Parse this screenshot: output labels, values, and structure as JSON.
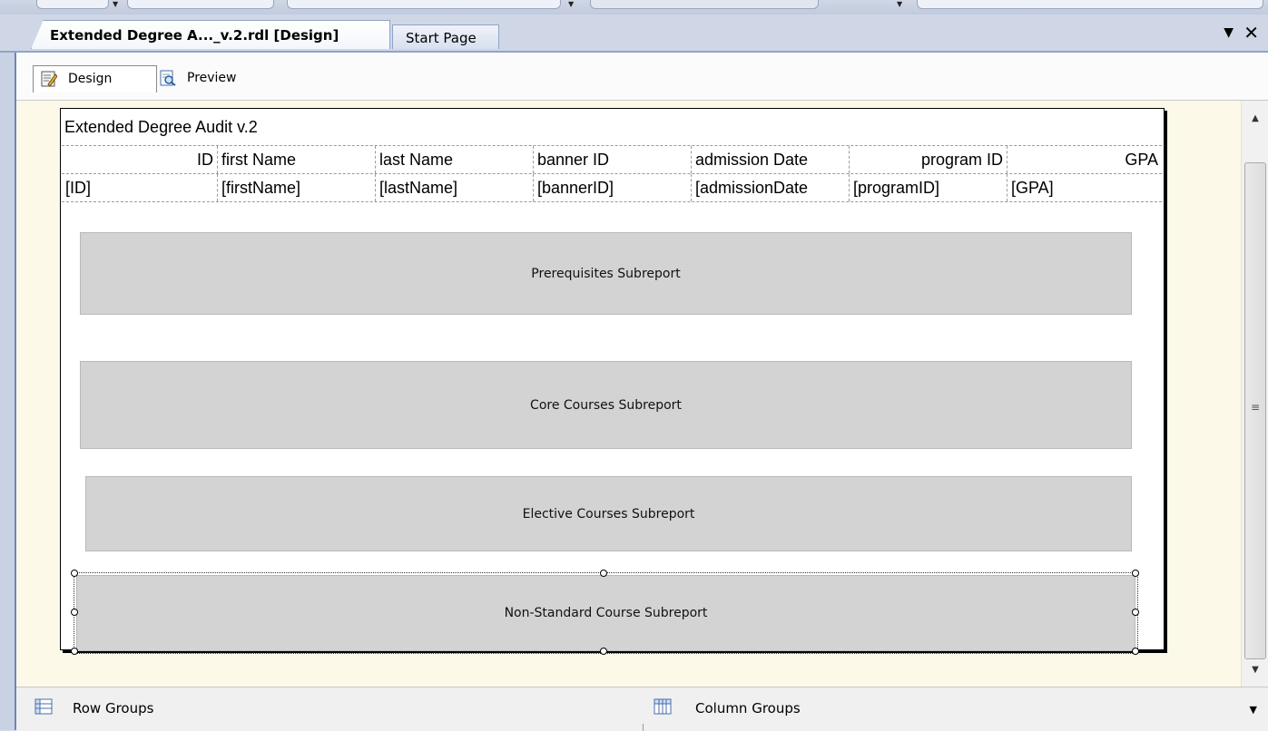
{
  "document_tabs": {
    "active_label": "Extended Degree A..._v.2.rdl [Design]",
    "inactive_label": "Start Page",
    "menu_glyph": "▼",
    "close_glyph": "✕"
  },
  "view_modes": {
    "design_label": "Design",
    "preview_label": "Preview"
  },
  "report": {
    "title": "Extended Degree Audit  v.2",
    "table": {
      "headers": [
        "ID",
        "first Name",
        "last Name",
        "banner ID",
        "admission Date",
        "program ID",
        "GPA"
      ],
      "fields": [
        "[ID]",
        "[firstName]",
        "[lastName]",
        "[bannerID]",
        "[admissionDate",
        "[programID]",
        "[GPA]"
      ]
    },
    "subreports": [
      "Prerequisites Subreport",
      "Core Courses Subreport",
      "Elective Courses Subreport",
      "Non-Standard Course Subreport"
    ]
  },
  "groups_pane": {
    "row_groups_label": "Row Groups",
    "column_groups_label": "Column Groups"
  },
  "colors": {
    "surface_bg": "#fdf9e8",
    "subreport_fill": "#d3d3d3",
    "tab_border": "#8fa4c8"
  }
}
